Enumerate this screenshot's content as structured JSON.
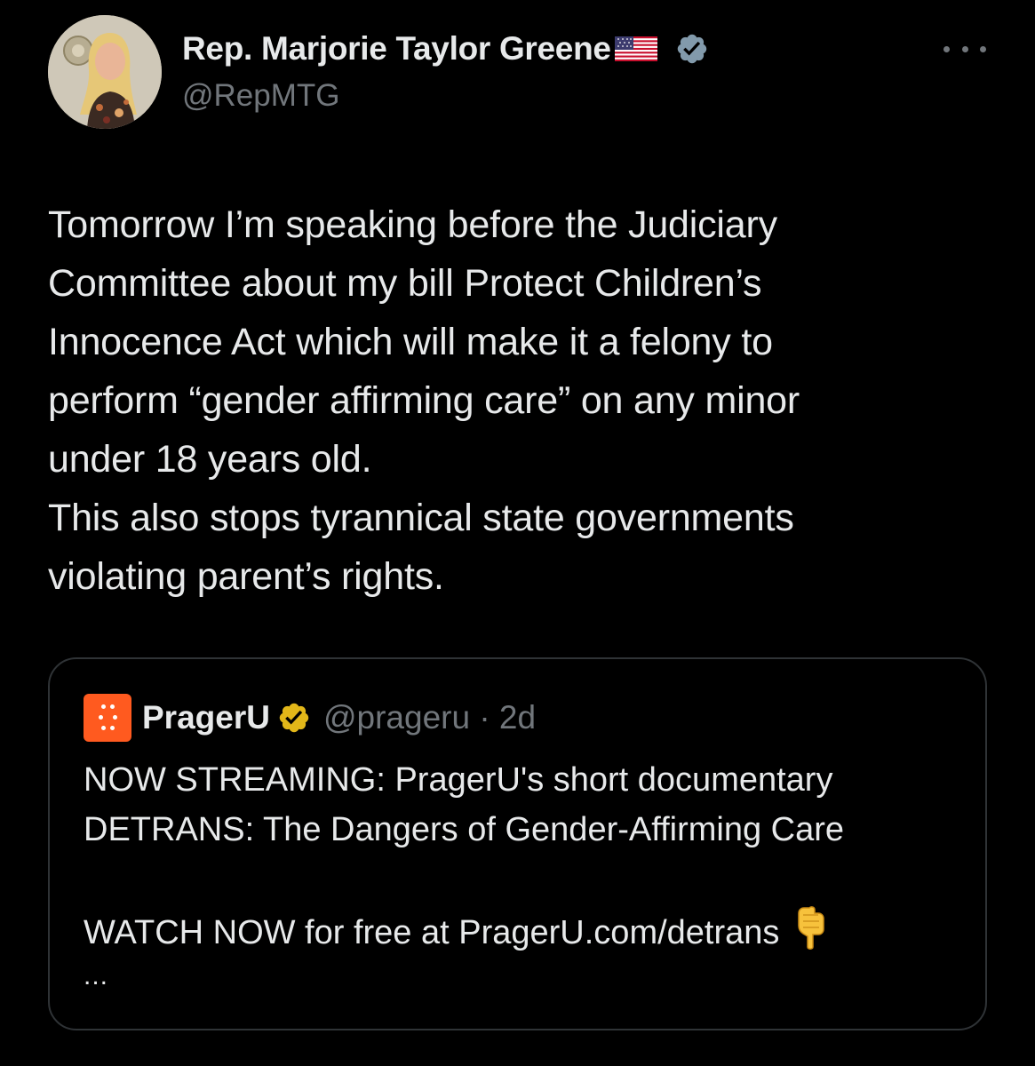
{
  "author": {
    "display_name": "Rep. Marjorie Taylor Greene",
    "handle": "@RepMTG",
    "flag_icon": "us-flag-icon",
    "verified_icon": "verified-badge-icon",
    "verified_color": "#829aab"
  },
  "tweet": {
    "text": "Tomorrow I’m speaking before the Judiciary\nCommittee about my bill Protect Children’s\nInnocence Act which will make it a felony to\nperform “gender affirming care” on any minor\nunder 18 years old.\nThis also stops tyrannical state governments\nviolating parent’s rights."
  },
  "quote": {
    "name": "PragerU",
    "handle_time": "@prageru · 2d",
    "logo_color": "#ff5a1f",
    "verified_color": "#e2b719",
    "text": "NOW STREAMING: PragerU's short documentary\nDETRANS: The Dangers of Gender-Affirming Care\n\nWATCH NOW for free at PragerU.com/detrans",
    "ellipsis": "..."
  },
  "colors": {
    "background": "#000000",
    "primary_text": "#e7e9ea",
    "secondary_text": "#71767b",
    "border": "#2f3336"
  }
}
